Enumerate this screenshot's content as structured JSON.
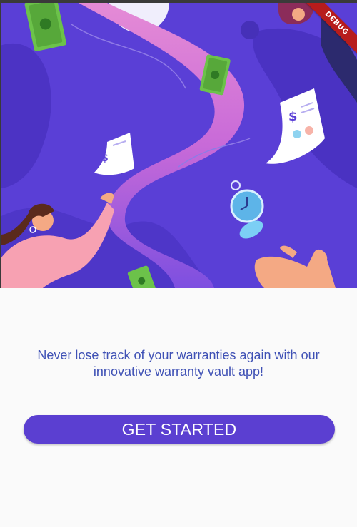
{
  "debug_banner": "DEBUG",
  "onboarding": {
    "tagline": "Never lose track of your warranties again with our innovative warranty vault app!",
    "cta_label": "GET STARTED"
  },
  "colors": {
    "hero_background": "#5a3fd6",
    "accent_button": "#5b3fd1",
    "tagline_text": "#3f51b5",
    "page_background": "#fafafa"
  },
  "illustration": {
    "icons": [
      "banknote-icon",
      "receipt-icon",
      "stopwatch-icon",
      "woman-illustration",
      "hand-illustration"
    ]
  }
}
